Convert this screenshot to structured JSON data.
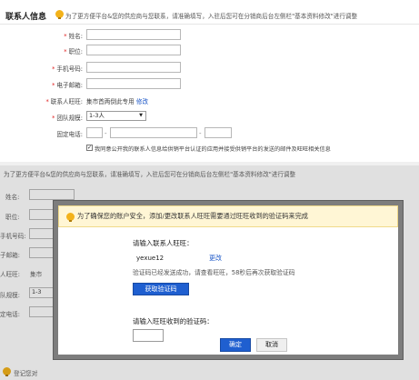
{
  "form": {
    "section_title": "联系人信息",
    "hint": "为了更方便平台&您的供应商与您联系，请准确填写，入驻后您可在分销商后台左侧栏\"基本资料修改\"进行调整",
    "fields": {
      "name_label": "姓名:",
      "position_label": "职位:",
      "mobile_label": "手机号码:",
      "email_label": "电子邮箱:",
      "wangwang_label": "联系人旺旺:",
      "wangwang_value": "集市首两倒此专用",
      "wangwang_edit": "修改",
      "team_label": "团队规模:",
      "team_value": "1-3人",
      "phone_label": "固定电话:"
    },
    "agree_text": "我同意公开我的联系人信息给供销平台认证的应用并接受供销平台的发送的邮件及旺旺相关信息"
  },
  "background": {
    "hint": "为了更方便平台&您的供应商与您联系，请准确填写，入驻后您可在分销商后台左侧栏\"基本资料修改\"进行调整",
    "name_label": "姓名:",
    "position_label": "职位:",
    "mobile_label": "手机号码:",
    "email_label": "子邮箱:",
    "wangwang_label": "人旺旺:",
    "wangwang_partial": "集市",
    "team_label": "队规模:",
    "team_partial": "1-3",
    "phone_label": "定电话:",
    "footer_label": "登记您对"
  },
  "dialog": {
    "warning": "为了确保您的账户安全，添加/更改联系人旺旺需要通过旺旺收到的验证码来完成",
    "enter_wangwang_label": "请输入联系人旺旺：",
    "wangwang_value": "yexue12",
    "change_link": "更改",
    "code_sent_text": "验证码已经发送成功，请查看旺旺，58秒后再次获取验证码",
    "get_code_button": "获取验证码",
    "enter_code_label": "请输入旺旺收到的验证码：",
    "confirm_button": "确定",
    "cancel_button": "取消"
  },
  "colors": {
    "primary_blue": "#1f5fd0",
    "link_blue": "#1a56c7",
    "required_red": "#e02020",
    "warning_bg": "#fff6d5",
    "bulb": "#f3b21a"
  }
}
